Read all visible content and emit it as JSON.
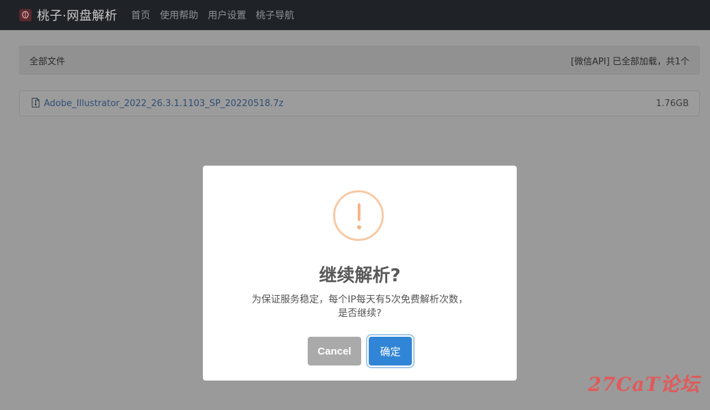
{
  "navbar": {
    "brand": "桃子·网盘解析",
    "items": [
      "首页",
      "使用帮助",
      "用户设置",
      "桃子导航"
    ]
  },
  "file_list": {
    "header_title": "全部文件",
    "header_status": "[微信API] 已全部加载，共1个",
    "files": [
      {
        "name": "Adobe_Illustrator_2022_26.3.1.1103_SP_20220518.7z",
        "size": "1.76GB"
      }
    ]
  },
  "modal": {
    "title": "继续解析?",
    "text_line1": "为保证服务稳定，每个IP每天有5次免费解析次数，",
    "text_line2": "是否继续?",
    "cancel_label": "Cancel",
    "confirm_label": "确定"
  },
  "watermark": "27CaT论坛",
  "colors": {
    "navbar_bg": "#1f2226",
    "confirm_button": "#3085d6",
    "cancel_button": "#aaaaaa",
    "warning_icon": "#f8bb86",
    "link": "#2f4d75"
  }
}
